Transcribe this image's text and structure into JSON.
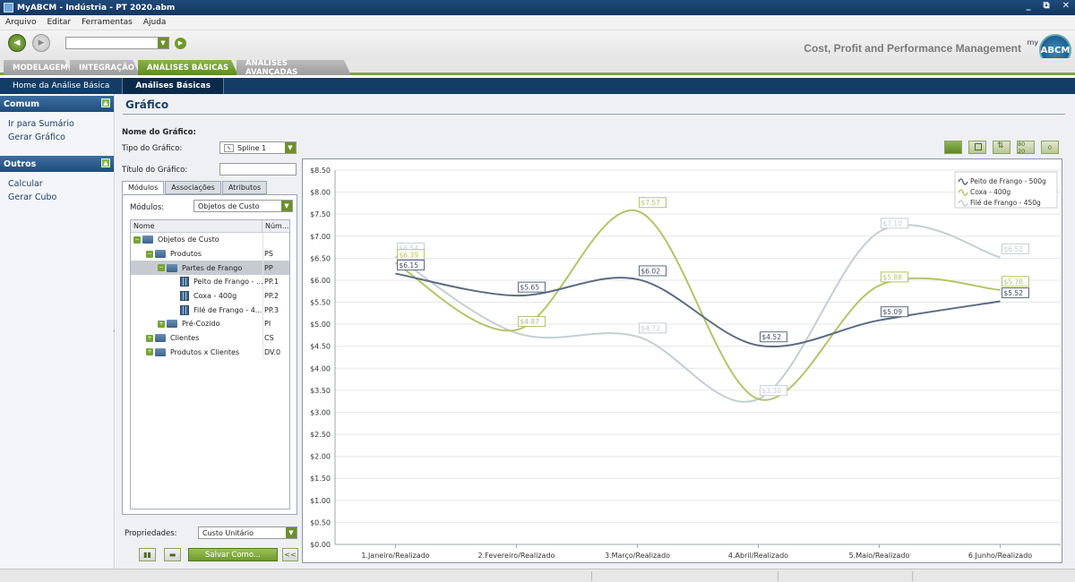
{
  "window": {
    "title": "MyABCM - Indústria - PT 2020.abm",
    "controls": [
      "_",
      "⧉",
      "✕"
    ]
  },
  "menu": [
    "Arquivo",
    "Editar",
    "Ferramentas",
    "Ajuda"
  ],
  "toolbar": {
    "tagline": "Cost, Profit and Performance Management",
    "logo_prefix": "my",
    "logo": "ABCM"
  },
  "main_tabs": [
    "MODELAGEM",
    "INTEGRAÇÃO",
    "ANÁLISES BÁSICAS",
    "ANÁLISES AVANÇADAS"
  ],
  "sub_nav": [
    "Home da Análise Básica",
    "Análises Básicas"
  ],
  "sidebar": {
    "comum": {
      "title": "Comum",
      "items": [
        "Ir para Sumário",
        "Gerar Gráfico"
      ]
    },
    "outros": {
      "title": "Outros",
      "items": [
        "Calcular",
        "Gerar Cubo"
      ]
    }
  },
  "form": {
    "page_title": "Gráfico",
    "nome_label": "Nome do Gráfico:",
    "tipo_label": "Tipo do Gráfico:",
    "tipo_value": "Spline 1",
    "titulo_label": "Título do Gráfico:",
    "titulo_value": "",
    "tabs": [
      "Módulos",
      "Associações",
      "Atributos"
    ],
    "modulos_label": "Módulos:",
    "modulos_value": "Objetos de Custo",
    "tree_headers": [
      "Nome",
      "Núm..."
    ],
    "tree": [
      {
        "name": "Objetos de Custo",
        "code": ""
      },
      {
        "name": "Produtos",
        "code": "PS"
      },
      {
        "name": "Partes de Frango",
        "code": "PP"
      },
      {
        "name": "Peito de Frango - ...",
        "code": "PP.1"
      },
      {
        "name": "Coxa - 400g",
        "code": "PP.2"
      },
      {
        "name": "Filé de Frango - 4...",
        "code": "PP.3"
      },
      {
        "name": "Pré-Cozido",
        "code": "PI"
      },
      {
        "name": "Clientes",
        "code": "CS"
      },
      {
        "name": "Produtos x Clientes",
        "code": "DV.0"
      }
    ],
    "propriedades_label": "Propriedades:",
    "propriedades_value": "Custo Unitário",
    "save_label": "Salvar Como...",
    "collapse_label": "<<"
  },
  "chart_buttons": [
    "",
    "",
    "",
    "80 20",
    "0"
  ],
  "chart_data": {
    "type": "line",
    "categories": [
      "1.Janeiro/Realizado",
      "2.Fevereiro/Realizado",
      "3.Março/Realizado",
      "4.Abril/Realizado",
      "5.Maio/Realizado",
      "6.Junho/Realizado"
    ],
    "series": [
      {
        "name": "Peito de Frango - 500g",
        "values": [
          6.15,
          5.65,
          6.02,
          4.52,
          5.09,
          5.52
        ],
        "labels": [
          "$6.15",
          "$5.65",
          "$6.02",
          "$4.52",
          "$5.09",
          "$5.52"
        ],
        "color": "#5b6b80"
      },
      {
        "name": "Coxa - 400g",
        "values": [
          6.39,
          4.87,
          7.57,
          3.3,
          5.88,
          5.78
        ],
        "labels": [
          "$6.39",
          "$4.87",
          "$7.57",
          "",
          "$5.88",
          "$5.78"
        ],
        "color": "#b4c46a"
      },
      {
        "name": "Filé de Frango - 450g",
        "values": [
          6.54,
          4.8,
          4.72,
          3.3,
          7.1,
          6.52
        ],
        "labels": [
          "$6.54",
          "",
          "$4.72",
          "$3.30",
          "$7.10",
          "$6.52"
        ],
        "color": "#c3cfd3"
      }
    ],
    "ylim": [
      0,
      8.5
    ],
    "ytick_labels": [
      "$0.00",
      "$0.50",
      "$1.00",
      "$1.50",
      "$2.00",
      "$2.50",
      "$3.00",
      "$3.50",
      "$4.00",
      "$4.50",
      "$5.00",
      "$5.50",
      "$6.00",
      "$6.50",
      "$7.00",
      "$7.50",
      "$8.00",
      "$8.50"
    ],
    "grid": true,
    "legend": "top-right"
  }
}
